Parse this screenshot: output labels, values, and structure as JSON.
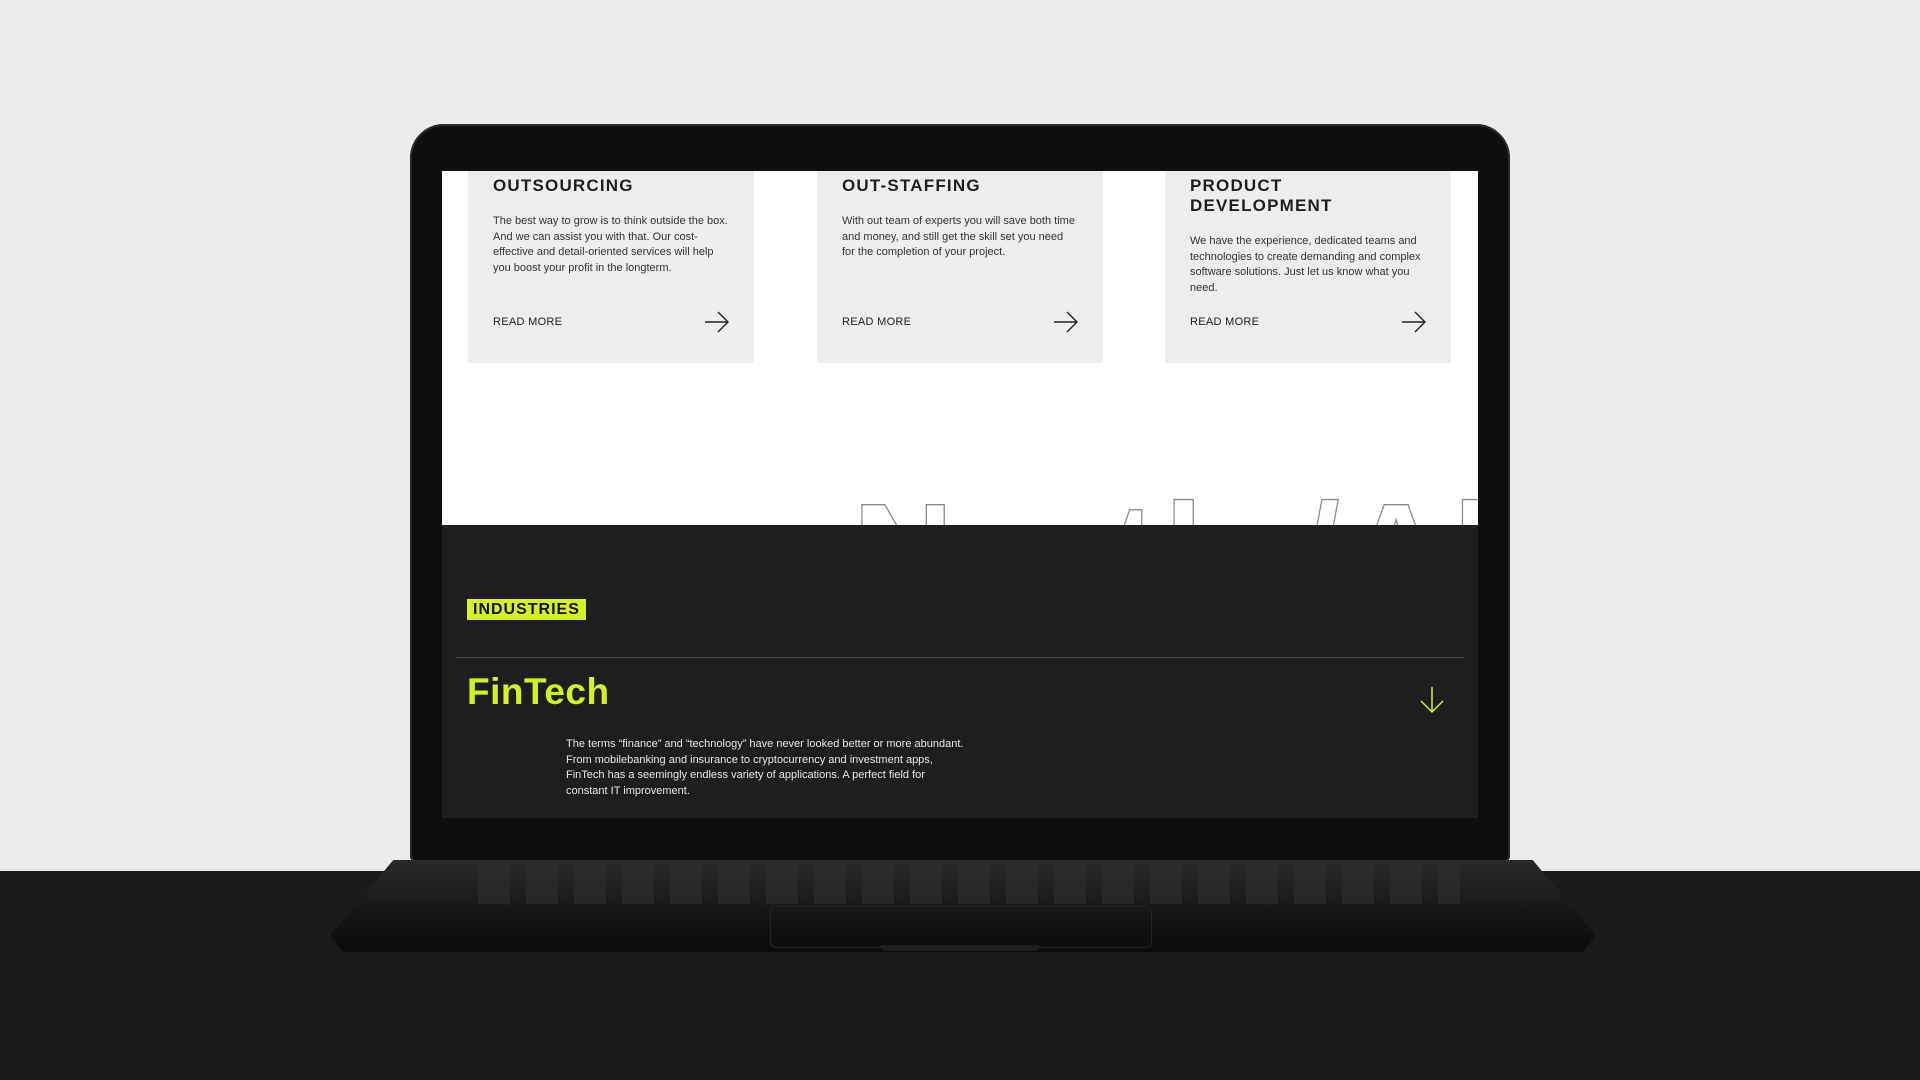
{
  "services": {
    "cards": [
      {
        "title": "OUTSOURCING",
        "text": "The best way to grow is to think outside the box. And we can assist you with that. Our cost-effective and detail-oriented services will help you boost your profit in the longterm.",
        "link": "READ MORE"
      },
      {
        "title": "OUT-STAFFING",
        "text": "With out team of experts you will save both time and money, and still get the skill set you need for the completion of your project.",
        "link": "READ MORE"
      },
      {
        "title": "PRODUCT DEVELOPMENT",
        "text": "We have the experience, dedicated teams and technologies to create demanding and complex software solutions. Just let us know what you need.",
        "link": "READ MORE"
      }
    ],
    "icons": {
      "read_more": "arrow-right-icon"
    }
  },
  "marquee": {
    "text": "ys go North /Al"
  },
  "industries": {
    "tag": "INDUSTRIES",
    "item": {
      "title": "FinTech",
      "text": "The terms “finance” and “technology” have never looked better or more abundant. From mobilebanking and insurance to cryptocurrency and investment apps, FinTech has a seemingly endless variety of applications. A perfect field for constant IT improvement.",
      "icon": "arrow-down-icon"
    }
  },
  "colors": {
    "accent": "#d4f21d",
    "dark_section": "#1e1e20",
    "card_bg": "#ededed",
    "background": "#ebebeb"
  }
}
